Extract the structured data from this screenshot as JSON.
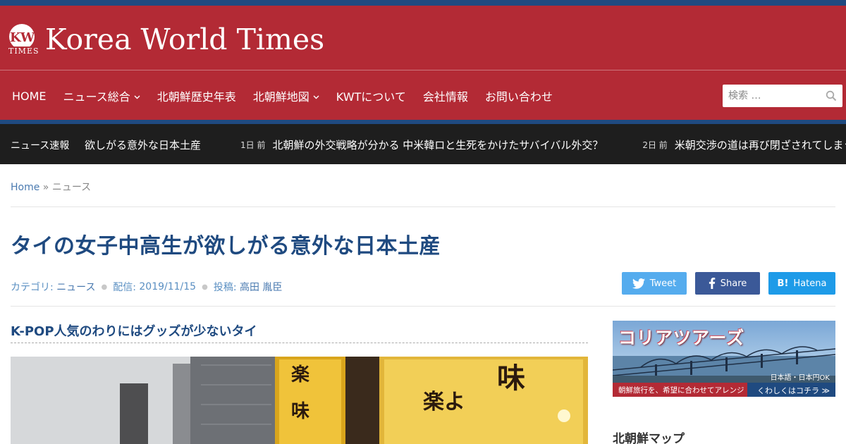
{
  "site": {
    "logo_mark": "KW TIMES",
    "name": "Korea World Times"
  },
  "nav": {
    "items": [
      {
        "label": "HOME",
        "has_dropdown": false
      },
      {
        "label": "ニュース総合",
        "has_dropdown": true
      },
      {
        "label": "北朝鮮歴史年表",
        "has_dropdown": false
      },
      {
        "label": "北朝鮮地図",
        "has_dropdown": true
      },
      {
        "label": "KWTについて",
        "has_dropdown": false
      },
      {
        "label": "会社情報",
        "has_dropdown": false
      },
      {
        "label": "お問い合わせ",
        "has_dropdown": false
      }
    ],
    "search_placeholder": "検索 …"
  },
  "ticker": {
    "label": "ニュース速報",
    "items": [
      {
        "time": "",
        "text": "欲しがる意外な日本土産"
      },
      {
        "time": "1日 前",
        "text": "北朝鮮の外交戦略が分かる 中米韓ロと生死をかけたサバイバル外交？"
      },
      {
        "time": "2日 前",
        "text": "米朝交渉の道は再び閉ざされてしまうのか"
      }
    ]
  },
  "breadcrumb": {
    "home": "Home",
    "separator": "»",
    "current": "ニュース"
  },
  "article": {
    "title": "タイの女子中高生が欲しがる意外な日本土産",
    "category_label": "カテゴリ:",
    "category": "ニュース",
    "date_label": "配信:",
    "date": "2019/11/15",
    "author_label": "投稿:",
    "author": "高田 胤臣",
    "section_heading": "K-POP人気のわりにはグッズが少ないタイ"
  },
  "share": {
    "twitter": "Tweet",
    "facebook": "Share",
    "hatena_mark": "B!",
    "hatena": "Hatena"
  },
  "sidebar": {
    "banner": {
      "title": "コリアツアーズ",
      "sub": "日本語・日本円OK",
      "slogan": "朝鮮旅行を、希望に合わせてアレンジ",
      "cta": "くわしくはコチラ ≫"
    },
    "map_heading": "北朝鮮マップ"
  },
  "colors": {
    "header_red": "#b32a35",
    "accent_blue": "#1f4a80",
    "ticker_bg": "#1e1e1e",
    "twitter": "#55acee",
    "facebook": "#3b5998",
    "hatena": "#1e9be8"
  }
}
